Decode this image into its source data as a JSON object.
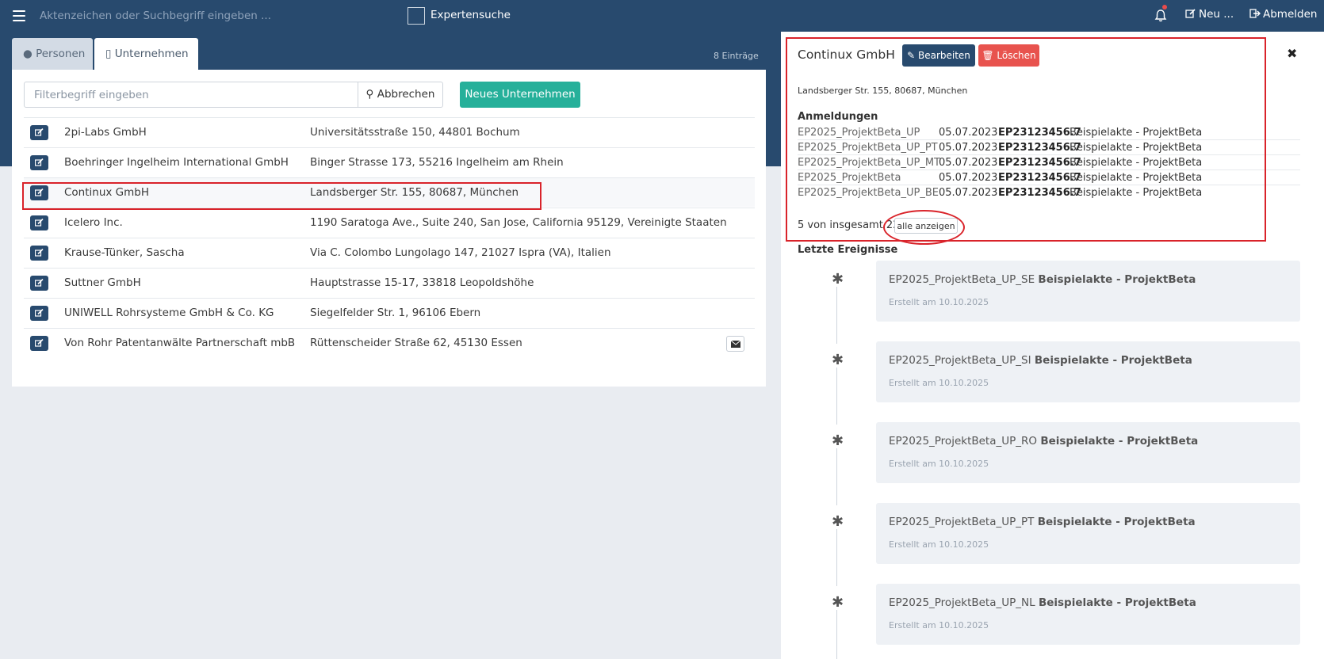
{
  "topbar": {
    "search_placeholder": "Aktenzeichen oder Suchbegriff eingeben ...",
    "expert_label": "Expertensuche",
    "new_label": "Neu ...",
    "logout_label": "Abmelden"
  },
  "tabs": {
    "personen": "Personen",
    "unternehmen": "Unternehmen",
    "entries_count": "8 Einträge"
  },
  "filter": {
    "placeholder": "Filterbegriff eingeben",
    "cancel_label": "Abbrechen",
    "new_company_label": "Neues Unternehmen"
  },
  "companies": [
    {
      "name": "2pi-Labs GmbH",
      "address": "Universitätsstraße 150, 44801 Bochum"
    },
    {
      "name": "Boehringer Ingelheim International GmbH",
      "address": "Binger Strasse 173, 55216 Ingelheim am Rhein"
    },
    {
      "name": "Continux GmbH",
      "address": "Landsberger Str. 155, 80687, München"
    },
    {
      "name": "Icelero Inc.",
      "address": "1190 Saratoga Ave., Suite 240, San Jose, California 95129, Vereinigte Staaten"
    },
    {
      "name": "Krause-Tünker, Sascha",
      "address": "Via C. Colombo Lungolago 147, 21027 Ispra (VA), Italien"
    },
    {
      "name": "Suttner GmbH",
      "address": "Hauptstrasse 15-17, 33818 Leopoldshöhe"
    },
    {
      "name": "UNIWELL Rohrsysteme GmbH & Co. KG",
      "address": "Siegelfelder Str. 1, 96106 Ebern"
    },
    {
      "name": "Von Rohr Patentanwälte Partnerschaft mbB",
      "address": "Rüttenscheider Straße 62, 45130 Essen"
    }
  ],
  "detail": {
    "title": "Continux GmbH",
    "edit_label": "Bearbeiten",
    "delete_label": "Löschen",
    "address": "Landsberger Str. 155, 80687, München",
    "registrations_heading": "Anmeldungen",
    "registrations": [
      {
        "ref": "EP2025_ProjektBeta_UP",
        "date": "05.07.2023",
        "number": "EP23123456.7",
        "desc": "Beispielakte - ProjektBeta"
      },
      {
        "ref": "EP2025_ProjektBeta_UP_PT",
        "date": "05.07.2023",
        "number": "EP23123456.7",
        "desc": "Beispielakte - ProjektBeta"
      },
      {
        "ref": "EP2025_ProjektBeta_UP_MT",
        "date": "05.07.2023",
        "number": "EP23123456.7",
        "desc": "Beispielakte - ProjektBeta"
      },
      {
        "ref": "EP2025_ProjektBeta",
        "date": "05.07.2023",
        "number": "EP23123456.7",
        "desc": "Beispielakte - ProjektBeta"
      },
      {
        "ref": "EP2025_ProjektBeta_UP_BE",
        "date": "05.07.2023",
        "number": "EP23123456.7",
        "desc": "Beispielakte - ProjektBeta"
      }
    ],
    "summary": "5 von insgesamt 22",
    "show_all_label": "alle anzeigen",
    "events_heading": "Letzte Ereignisse",
    "events": [
      {
        "ref": "EP2025_ProjektBeta_UP_SE",
        "title": "Beispielakte - ProjektBeta",
        "created": "Erstellt am 10.10.2025"
      },
      {
        "ref": "EP2025_ProjektBeta_UP_SI",
        "title": "Beispielakte - ProjektBeta",
        "created": "Erstellt am 10.10.2025"
      },
      {
        "ref": "EP2025_ProjektBeta_UP_RO",
        "title": "Beispielakte - ProjektBeta",
        "created": "Erstellt am 10.10.2025"
      },
      {
        "ref": "EP2025_ProjektBeta_UP_PT",
        "title": "Beispielakte - ProjektBeta",
        "created": "Erstellt am 10.10.2025"
      },
      {
        "ref": "EP2025_ProjektBeta_UP_NL",
        "title": "Beispielakte - ProjektBeta",
        "created": "Erstellt am 10.10.2025"
      }
    ],
    "event_marker": "✱"
  },
  "icons": {
    "menu": "menu-icon",
    "bell": "bell-icon",
    "edit": "edit-icon",
    "logout": "logout-icon",
    "mail": "envelope-icon",
    "search": "search-icon",
    "user": "user-icon",
    "building": "building-icon",
    "trash": "trash-icon",
    "close": "close-icon"
  },
  "colors": {
    "header": "#284a6e",
    "primary_button": "#26b09a",
    "danger_button": "#e8534e",
    "annotation_red": "#d9232a"
  }
}
